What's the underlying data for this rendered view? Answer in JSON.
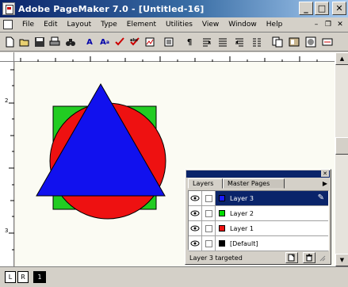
{
  "window": {
    "title": "Adobe PageMaker 7.0 - [Untitled-16]",
    "minimize_label": "_",
    "maximize_label": "□",
    "close_label": "✕"
  },
  "menubar": {
    "items": [
      "File",
      "Edit",
      "Layout",
      "Type",
      "Element",
      "Utilities",
      "View",
      "Window",
      "Help"
    ],
    "mdi_minimize": "–",
    "mdi_restore": "❐",
    "mdi_close": "✕"
  },
  "rulers": {
    "vertical_labels": [
      "2",
      "3"
    ]
  },
  "shapes": {
    "square_color": "#22cc22",
    "circle_color": "#ee1111",
    "triangle_color": "#1111ee"
  },
  "page_tabs": {
    "left": "L",
    "right": "R",
    "page": "1"
  },
  "layers_palette": {
    "tabs": [
      "Layers",
      "Master Pages"
    ],
    "layers": [
      {
        "name": "Layer 3",
        "color": "#1a1aff",
        "selected": true
      },
      {
        "name": "Layer 2",
        "color": "#00dd00",
        "selected": false
      },
      {
        "name": "Layer 1",
        "color": "#ee1111",
        "selected": false
      },
      {
        "name": "[Default]",
        "color": "#000000",
        "selected": false
      }
    ],
    "status": "Layer 3 targeted",
    "menu_arrow": "▶",
    "close_label": "✕"
  }
}
